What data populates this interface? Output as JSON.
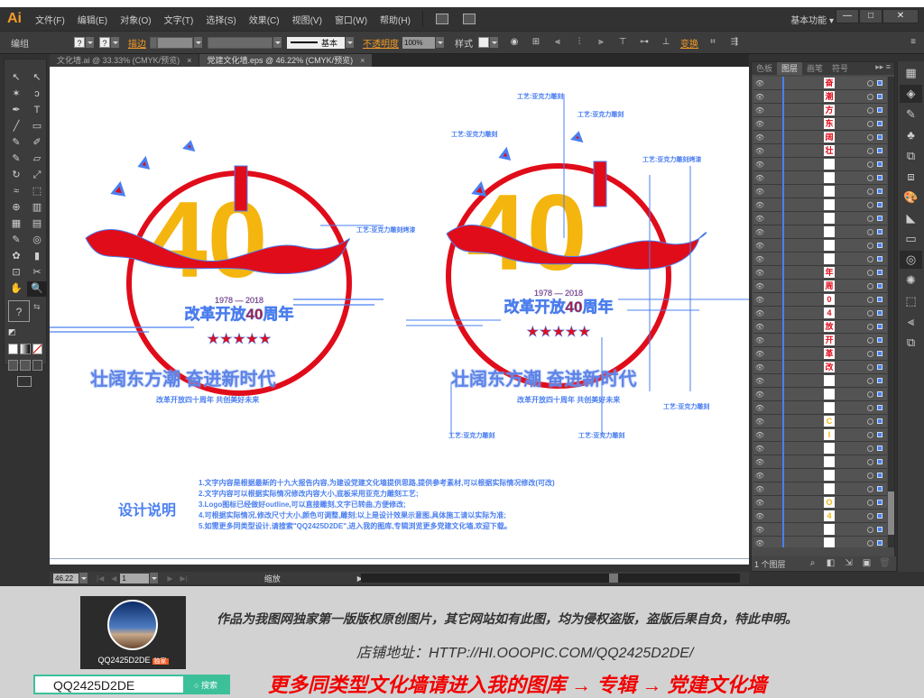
{
  "app": {
    "logo": "Ai",
    "menu": [
      "文件(F)",
      "编辑(E)",
      "对象(O)",
      "文字(T)",
      "选择(S)",
      "效果(C)",
      "视图(V)",
      "窗口(W)",
      "帮助(H)"
    ],
    "workspace": "基本功能",
    "window_buttons": {
      "minimize": "—",
      "maximize": "□",
      "close": "✕"
    }
  },
  "control_bar": {
    "selection_label": "编组",
    "fill_value": "?",
    "stroke_value": "?",
    "stroke_label": "描边",
    "stroke_style": "基本",
    "opacity_label": "不透明度",
    "opacity_value": "100%",
    "style_label": "样式",
    "transform_label": "变换"
  },
  "tabs": [
    {
      "label": "文化墙.ai @ 33.33% (CMYK/预览)",
      "active": false
    },
    {
      "label": "党建文化墙.eps @ 46.22% (CMYK/预览)",
      "active": true
    }
  ],
  "tools": [
    "selection",
    "direct-selection",
    "magic-wand",
    "lasso",
    "pen",
    "type",
    "line-segment",
    "rectangle",
    "paintbrush",
    "pencil",
    "blob-brush",
    "eraser",
    "rotate",
    "scale",
    "warp",
    "free-transform",
    "shape-builder",
    "perspective-grid",
    "mesh",
    "gradient",
    "eyedropper",
    "blend",
    "symbol-sprayer",
    "column-graph",
    "artboard",
    "slice",
    "hand",
    "zoom"
  ],
  "tool_glyphs": [
    "↖",
    "↖",
    "✶",
    "ↄ",
    "✒",
    "T",
    "╱",
    "▭",
    "✎",
    "✐",
    "✎",
    "▱",
    "↻",
    "⤢",
    "≈",
    "⬚",
    "⊕",
    "▥",
    "▦",
    "▤",
    "✎",
    "◎",
    "✿",
    "▮",
    "⊡",
    "✂",
    "✋",
    "🔍"
  ],
  "fill_stroke": {
    "fill": "?"
  },
  "canvas": {
    "left_art": {
      "year_range": "1978 — 2018",
      "title": "改革开放40周年",
      "slogan": "壮阔东方潮 奋进新时代",
      "subslogan": "改革开放四十周年 共创美好未来"
    },
    "right_art": {
      "year_range": "1978 — 2018",
      "title": "改革开放40周年",
      "slogan": "壮阔东方潮 奋进新时代",
      "subslogan": "改革开放四十周年 共创美好未来"
    },
    "annotations": [
      "工艺:亚克力雕刻",
      "工艺:亚克力雕刻",
      "工艺:亚克力雕刻",
      "工艺:亚克力雕刻烤漆",
      "工艺:亚克力雕刻烤漆",
      "工艺:亚克力雕刻",
      "工艺:亚克力雕刻",
      "工艺:亚克力雕刻"
    ],
    "design_title": "设计说明",
    "design_desc": [
      "1.文字内容是根据最新的十九大报告内容,为建设党建文化墙提供思路,提供参考素材,可以根据实际情况修改(可改)",
      "2.文字内容可以根据实际情况修改内容大小,底板采用亚克力雕刻工艺;",
      "3.Logo图标已经做好outline,可以直接雕刻,文字已转曲,方便修改;",
      "4.可根据实际情况,修改尺寸大小,颜色可调整,雕刻;以上是设计效果示意图,具体施工请以实际为准;",
      "5.如需更多同类型设计,请搜索\"QQ2425D2DE\",进入我的图库,专辑浏览更多党建文化墙,欢迎下载。"
    ]
  },
  "status_bar": {
    "zoom": "46.22",
    "page": "1",
    "label": "缩放"
  },
  "layers_panel": {
    "tabs": [
      "色板",
      "图层",
      "画笔",
      "符号"
    ],
    "active_tab": "图层",
    "rows": [
      "奋",
      "潮",
      "方",
      "东",
      "阔",
      "壮",
      "bird",
      "bird",
      "bird",
      "bird",
      "line",
      "line",
      "line",
      "line",
      "年",
      "周",
      "0",
      "4",
      "放",
      "开",
      "革",
      "改",
      "line",
      "ribbon",
      "ribbon",
      "C",
      "I",
      "ribbon",
      "ribbon",
      "ribbon",
      "ribbon",
      "O",
      "4",
      "tower",
      "circle",
      "rect"
    ],
    "footer_label": "1 个图层"
  },
  "footer": {
    "username": "QQ2425D2DE",
    "badge": "独家",
    "copyright": "作品为我图网独家第一版版权原创图片，其它网站如有此图，均为侵权盗版，盗版后果自负，特此申明。",
    "shop_url": "店铺地址：HTTP://HI.OOOPIC.COM/QQ2425D2DE/",
    "promo": "更多同类型文化墙请进入我的图库 → 专辑 → 党建文化墙",
    "search_value": "QQ2425D2DE",
    "search_button": "搜索"
  },
  "colors": {
    "accent_orange": "#f29a27",
    "selection_blue": "#4b7ff0",
    "ribbon_red": "#e00c1a",
    "number_yellow": "#f5b50f",
    "promo_red": "#f20000",
    "search_green": "#3cc09a"
  }
}
